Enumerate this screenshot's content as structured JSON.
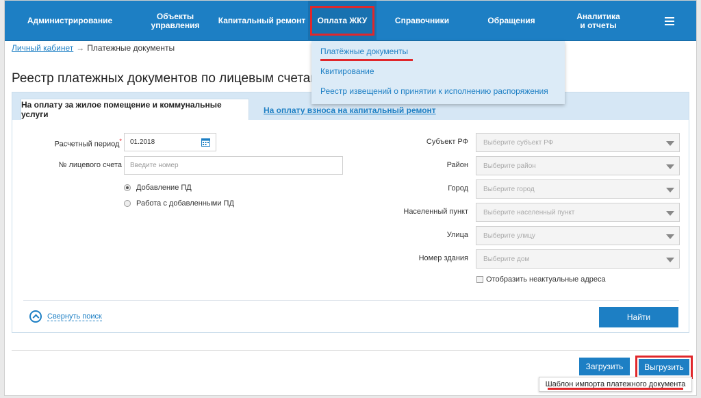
{
  "nav": {
    "items": [
      {
        "label": "Администрирование"
      },
      {
        "label": "Объекты управления"
      },
      {
        "label": "Капитальный ремонт"
      },
      {
        "label": "Оплата ЖКУ"
      },
      {
        "label": "Справочники"
      },
      {
        "label": "Обращения"
      },
      {
        "label": "Аналитика и отчеты"
      }
    ],
    "menu_icon": "hamburger-menu-icon"
  },
  "dropdown": {
    "items": [
      {
        "label": "Платёжные документы"
      },
      {
        "label": "Квитирование"
      },
      {
        "label": "Реестр извещений о принятии к исполнению распоряжения"
      }
    ]
  },
  "breadcrumb": {
    "home": "Личный кабинет",
    "arrow": "→",
    "current": "Платежные документы"
  },
  "page_title": "Реестр платежных документов по лицевым счетам",
  "tabs": {
    "active": "На оплату за жилое помещение и коммунальные услуги",
    "other": "На оплату взноса на капитальный ремонт"
  },
  "form": {
    "period_label": "Расчетный период",
    "period_required": "*",
    "period_value": "01.2018",
    "account_label": "№ лицевого счета",
    "account_placeholder": "Введите номер",
    "radio_add": "Добавление ПД",
    "radio_work": "Работа с добавленными ПД",
    "region_label": "Субъект РФ",
    "region_placeholder": "Выберите субъект РФ",
    "district_label": "Район",
    "district_placeholder": "Выберите район",
    "city_label": "Город",
    "city_placeholder": "Выберите город",
    "settlement_label": "Населенный пункт",
    "settlement_placeholder": "Выберите населенный пункт",
    "street_label": "Улица",
    "street_placeholder": "Выберите улицу",
    "house_label": "Номер здания",
    "house_placeholder": "Выберите дом",
    "show_inactive": "Отобразить неактуальные адреса",
    "collapse": "Свернуть поиск",
    "find": "Найти"
  },
  "actions": {
    "upload": "Загрузить",
    "export": "Выгрузить",
    "tooltip": "Шаблон импорта платежного документа"
  },
  "colors": {
    "primary": "#1d7fc4",
    "highlight": "#e0272b"
  }
}
